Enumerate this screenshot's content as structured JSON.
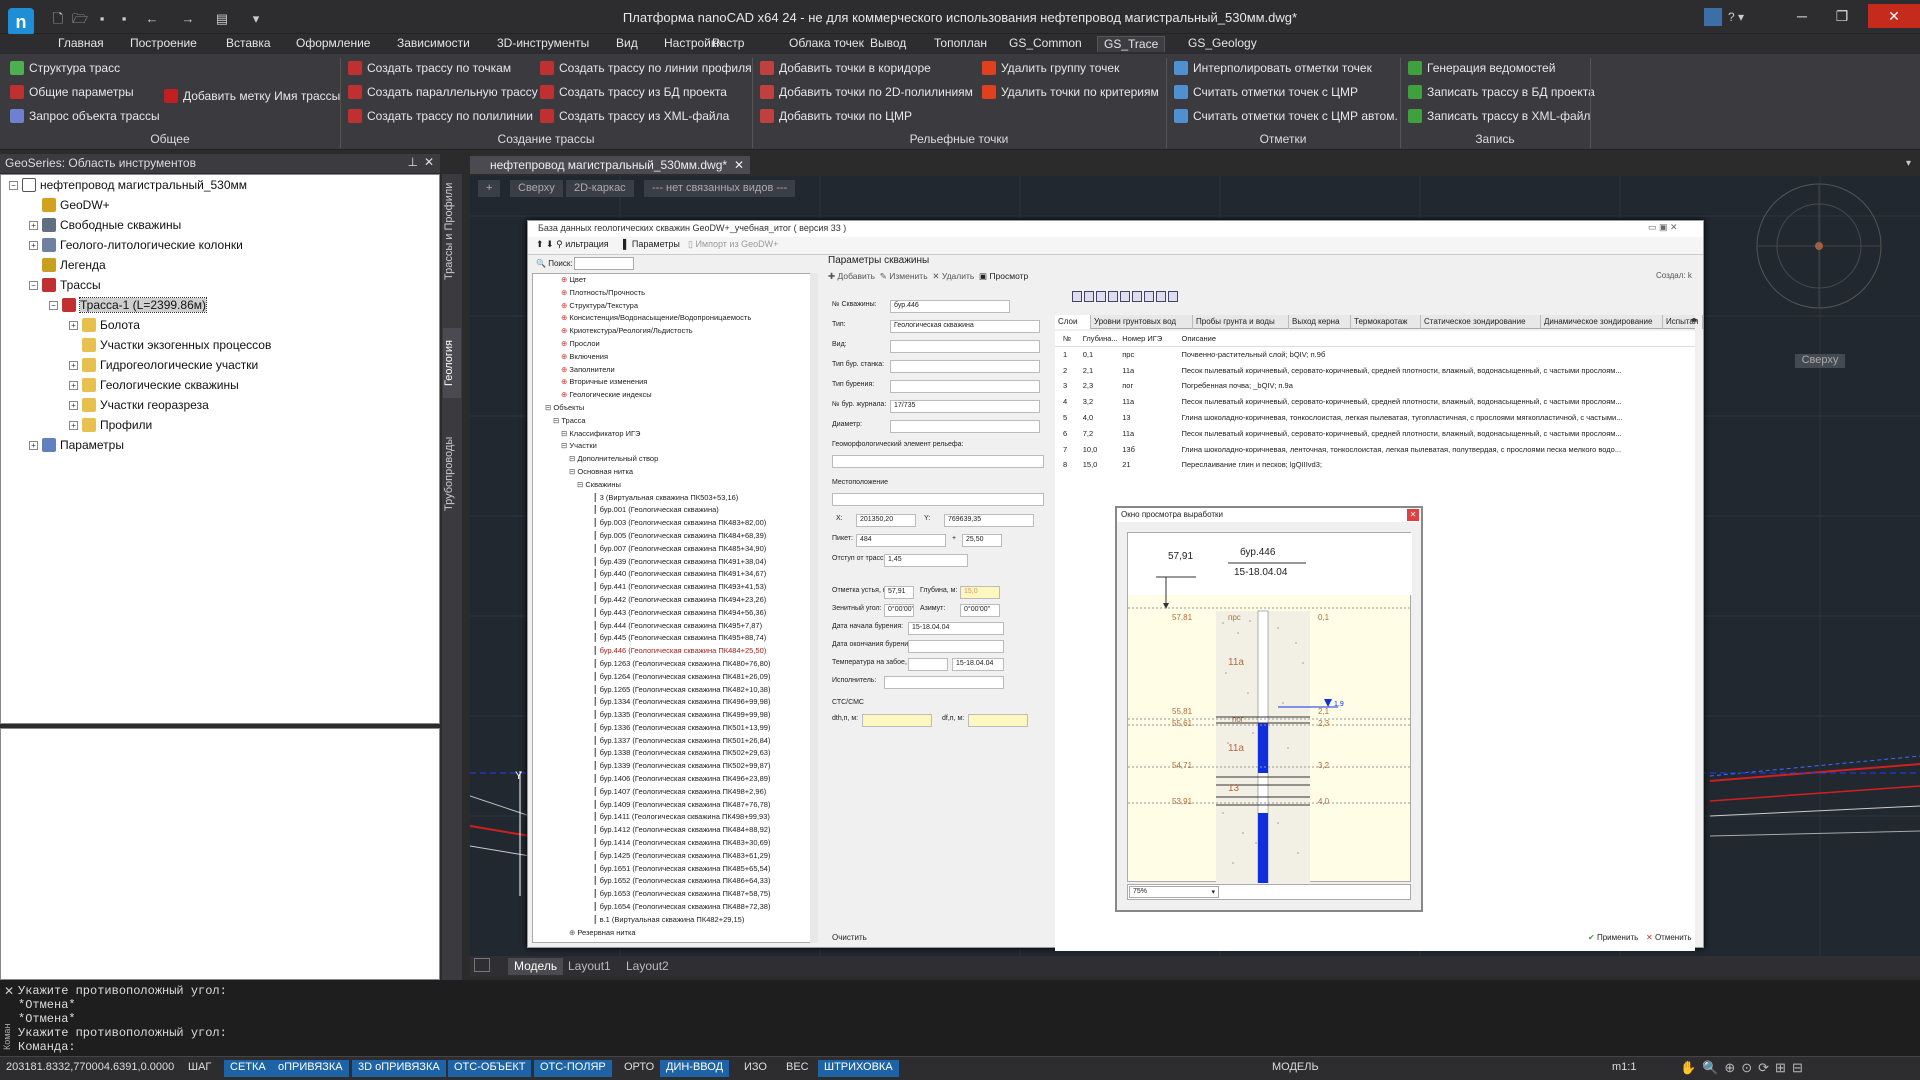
{
  "window": {
    "title": "Платформа nanoCAD x64 24 - не для коммерческого использования нефтепровод магистральный_530мм.dwg*",
    "logo": "n"
  },
  "menu": [
    "Главная",
    "Построение",
    "Вставка",
    "Оформление",
    "Зависимости",
    "3D-инструменты",
    "Вид",
    "Настройки",
    "Растр",
    "Облака точек",
    "Вывод",
    "Топоплан",
    "GS_Common",
    "GS_Trace",
    "GS_Geology"
  ],
  "ribbon": {
    "groups": {
      "general": {
        "title": "Общее",
        "items": [
          "Структура трасс",
          "Общие параметры",
          "Запрос объекта трассы",
          "Добавить метку Имя трассы"
        ]
      },
      "create": {
        "title": "Создание трассы",
        "items": [
          "Создать трассу по точкам",
          "Создать параллельную трассу",
          "Создать трассу по полилинии",
          "Создать трассу по линии профиля",
          "Создать трассу из БД проекта",
          "Создать трассу из XML-файла"
        ]
      },
      "relief": {
        "title": "Рельефные точки",
        "items": [
          "Добавить точки в коридоре",
          "Добавить точки по 2D-полилиниям",
          "Добавить точки по ЦМР",
          "Удалить группу точек",
          "Удалить точки по критериям"
        ]
      },
      "marks": {
        "title": "Отметки",
        "items": [
          "Интерполировать отметки точек",
          "Считать отметки точек с ЦМР",
          "Считать отметки точек с ЦМР автом."
        ]
      },
      "write": {
        "title": "Запись",
        "items": [
          "Генерация ведомостей",
          "Записать трассу в БД проекта",
          "Записать трассу в XML-файл"
        ]
      }
    }
  },
  "leftpanel": {
    "title": "GeoSeries: Область инструментов",
    "tree": [
      {
        "label": "нефтепровод магистральный_530мм",
        "level": 0,
        "exp": "-",
        "icon": "doc-icon"
      },
      {
        "label": "GeoDW+",
        "level": 1,
        "exp": "",
        "icon": "db-icon"
      },
      {
        "label": "Свободные скважины",
        "level": 1,
        "exp": "+",
        "icon": "well-icon"
      },
      {
        "label": "Геолого-литологические колонки",
        "level": 1,
        "exp": "+",
        "icon": "column-icon"
      },
      {
        "label": "Легенда",
        "level": 1,
        "exp": "",
        "icon": "book-icon"
      },
      {
        "label": "Трассы",
        "level": 1,
        "exp": "-",
        "icon": "route-icon"
      },
      {
        "label": "Трасса-1 (L=2399.86м)",
        "level": 2,
        "exp": "-",
        "icon": "route-icon",
        "selected": true
      },
      {
        "label": "Болота",
        "level": 3,
        "exp": "+",
        "icon": "folder-icon"
      },
      {
        "label": "Участки экзогенных процессов",
        "level": 3,
        "exp": "",
        "icon": "folder-icon"
      },
      {
        "label": "Гидрогеологические участки",
        "level": 3,
        "exp": "+",
        "icon": "folder-icon"
      },
      {
        "label": "Геологические скважины",
        "level": 3,
        "exp": "+",
        "icon": "folder-icon"
      },
      {
        "label": "Участки георазреза",
        "level": 3,
        "exp": "+",
        "icon": "folder-icon"
      },
      {
        "label": "Профили",
        "level": 3,
        "exp": "+",
        "icon": "folder-icon"
      },
      {
        "label": "Параметры",
        "level": 1,
        "exp": "+",
        "icon": "params-icon"
      }
    ],
    "vtabs": [
      "Трассы и Профили",
      "Геология",
      "Трубопроводы"
    ]
  },
  "document": {
    "tab": "нефтепровод магистральный_530мм.dwg*",
    "viewport_buttons": [
      "+",
      "Сверху",
      "2D-каркас",
      "--- нет связанных видов ---"
    ],
    "viewcube_label": "Сверху",
    "layout_tabs": [
      "Модель",
      "Layout1",
      "Layout2"
    ]
  },
  "dialog": {
    "title": "База данных геологических скважин GeoDW+_учебная_итог ( версия 33 )",
    "toolbar": [
      "ильтрация",
      "Параметры",
      "Импорт из GeoDW+"
    ],
    "search_label": "Поиск:",
    "tree_top": [
      "Цвет",
      "Плотность/Прочность",
      "Структура/Текстура",
      "Консистенция/Водонасыщение/Водопроницаемость",
      "Криотекстура/Реология/Льдистость",
      "Прослои",
      "Включения",
      "Заполнители",
      "Вторичные изменения",
      "Геологические индексы",
      "Объекты",
      "Трасса",
      "Классификатор ИГЭ",
      "Участки",
      "Дополнительный створ",
      "Основная нитка",
      "Скважины"
    ],
    "wells": [
      "3 (Виртуальная скважина ПК503+53,16)",
      "бур.001 (Геологическая скважина)",
      "бур.003 (Геологическая скважина ПК483+82,00)",
      "бур.005 (Геологическая скважина ПК484+68,39)",
      "бур.007 (Геологическая скважина ПК485+34,90)",
      "бур.439 (Геологическая скважина ПК491+38,04)",
      "бур.440 (Геологическая скважина ПК491+34,67)",
      "бур.441 (Геологическая скважина ПК493+41,53)",
      "бур.442 (Геологическая скважина ПК494+23,26)",
      "бур.443 (Геологическая скважина ПК494+56,36)",
      "бур.444 (Геологическая скважина ПК495+7,87)",
      "бур.445 (Геологическая скважина ПК495+88,74)",
      "бур.446 (Геологическая скважина ПК484+25,50)",
      "бур.1263 (Геологическая скважина ПК480+76,80)",
      "бур.1264 (Геологическая скважина ПК481+26,09)",
      "бур.1265 (Геологическая скважина ПК482+10,38)",
      "бур.1334 (Геологическая скважина ПК496+99,98)",
      "бур.1335 (Геологическая скважина ПК499+99,98)",
      "бур.1336 (Геологическая скважина ПК501+13,99)",
      "бур.1337 (Геологическая скважина ПК501+26,84)",
      "бур.1338 (Геологическая скважина ПК502+29,63)",
      "бур.1339 (Геологическая скважина ПК502+99,87)",
      "бур.1406 (Геологическая скважина ПК496+23,89)",
      "бур.1407 (Геологическая скважина ПК498+2,96)",
      "бур.1409 (Геологическая скважина ПК487+76,78)",
      "бур.1411 (Геологическая скважина ПК498+99,93)",
      "бур.1412 (Геологическая скважина ПК484+88,92)",
      "бур.1414 (Геологическая скважина ПК483+30,69)",
      "бур.1425 (Геологическая скважина ПК483+61,29)",
      "бур.1651 (Геологическая скважина ПК485+65,54)",
      "бур.1652 (Геологическая скважина ПК486+64,33)",
      "бур.1653 (Геологическая скважина ПК487+58,75)",
      "бур.1654 (Геологическая скважина ПК488+72,38)",
      "в.1 (Виртуальная скважина ПК482+29,15)",
      "Резервная нитка"
    ],
    "params_title": "Параметры скважины",
    "params_toolbar": [
      "Добавить",
      "Изменить",
      "Удалить",
      "Просмотр"
    ],
    "created_label": "Создал: k",
    "fields": {
      "well_no_label": "№ Скважины:",
      "well_no": "бур.446",
      "type_label": "Тип:",
      "type": "Геологическая скважина",
      "kind_label": "Вид:",
      "rig_label": "Тип бур. станка:",
      "drill_label": "Тип бурения:",
      "journal_label": "№ бур. журнала:",
      "journal": "17/735",
      "diameter_label": "Диаметр:",
      "geomorph_label": "Геоморфологический элемент рельефа:",
      "location_label": "Местоположение",
      "x_label": "X:",
      "x": "201350,20",
      "y_label": "Y:",
      "y": "769639,35",
      "picket_label": "Пикет:",
      "picket": "484",
      "plus": "+",
      "picket2": "25,50",
      "offset_label": "Отступ от трассы:",
      "offset": "1,45",
      "mouth_label": "Отметка устья, м:",
      "mouth": "57,91",
      "depth_label": "Глубина, м:",
      "depth": "15,0",
      "zenith_label": "Зенитный угол:",
      "zenith": "0°00'00\"",
      "azimuth_label": "Азимут:",
      "azimuth": "0°00'00\"",
      "start_label": "Дата начала бурения:",
      "start": "15-18.04.04",
      "end_label": "Дата окончания бурения:",
      "temp_label": "Температура на забое, °С:",
      "temp_date": "15-18.04.04",
      "executor_label": "Исполнитель:",
      "cpt_label": "СТС/СМС",
      "dth_label": "dth,п, м:",
      "dfn_label": "df,п, м:"
    },
    "footer_left": "Очистить",
    "apply": "Применить",
    "cancel": "Отменить",
    "layer_tabs": [
      "Слои",
      "Уровни грунтовых вод",
      "Пробы грунта и воды",
      "Выход керна",
      "Термокаротаж",
      "Статическое зондирование",
      "Динамическое зондирование",
      "Испытан"
    ],
    "layer_headers": [
      "№",
      "Глубина...",
      "Номер ИГЭ",
      "Описание"
    ],
    "layers": [
      [
        "1",
        "0,1",
        "прс",
        "Почвенно-растительный слой; bQIV; п.9б"
      ],
      [
        "2",
        "2,1",
        "11а",
        "Песок пылеватый коричневый, серовато-коричневый, средней плотности, влажный, водонасыщенный, с частыми прослоям..."
      ],
      [
        "3",
        "2,3",
        "пог",
        "Погребенная почва; _bQIV; п.9а"
      ],
      [
        "4",
        "3,2",
        "11а",
        "Песок пылеватый коричневый, серовато-коричневый, средней плотности, влажный, водонасыщенный, с частыми прослоям..."
      ],
      [
        "5",
        "4,0",
        "13",
        "Глина шоколадно-коричневая, тонкослоистая, легкая пылеватая, тугопластичная, с прослоями мягкопластичной, с частыми..."
      ],
      [
        "6",
        "7,2",
        "11а",
        "Песок пылеватый коричневый, серовато-коричневый, средней плотности, влажный, водонасыщенный, с частыми прослоям..."
      ],
      [
        "7",
        "10,0",
        "13б",
        "Глина шоколадно-коричневая, ленточная, тонкослоистая, легкая пылеватая, полутвердая, с прослоями песка мелкого водо..."
      ],
      [
        "8",
        "15,0",
        "21",
        "Переслаивание глин и песков; lgQIIIvd3;"
      ]
    ]
  },
  "preview": {
    "title": "Окно просмотра выработки",
    "elev": "57,91",
    "well": "бур.446",
    "date": "15-18.04.04",
    "marks_left": [
      "57,81",
      "55,81",
      "55,61",
      "54,71",
      "53,91"
    ],
    "marks_right": [
      "0,1",
      "2,1",
      "2,3",
      "3,2",
      "4,0"
    ],
    "water": "1,9",
    "ige": [
      "прс",
      "11а",
      "пог",
      "11а",
      "13"
    ],
    "zoom": "75%"
  },
  "command": {
    "lines": [
      "Укажите противоположный угол:",
      "*Отмена*",
      "*Отмена*",
      "Укажите противоположный угол:",
      "Команда:"
    ],
    "side": "Коман"
  },
  "status": {
    "coords": "203181.8332,770004.6391,0.0000",
    "toggles": [
      {
        "label": "ШАГ",
        "on": false
      },
      {
        "label": "СЕТКА",
        "on": true
      },
      {
        "label": "оПРИВЯЗКА",
        "on": true
      },
      {
        "label": "3D оПРИВЯЗКА",
        "on": true
      },
      {
        "label": "ОТС-ОБЪЕКТ",
        "on": true
      },
      {
        "label": "ОТС-ПОЛЯР",
        "on": true
      },
      {
        "label": "ОРТО",
        "on": false
      },
      {
        "label": "ДИН-ВВОД",
        "on": true
      },
      {
        "label": "ИЗО",
        "on": false
      },
      {
        "label": "ВЕС",
        "on": false
      },
      {
        "label": "ШТРИХОВКА",
        "on": true
      }
    ],
    "space": "МОДЕЛЬ",
    "scale": "m1:1"
  }
}
